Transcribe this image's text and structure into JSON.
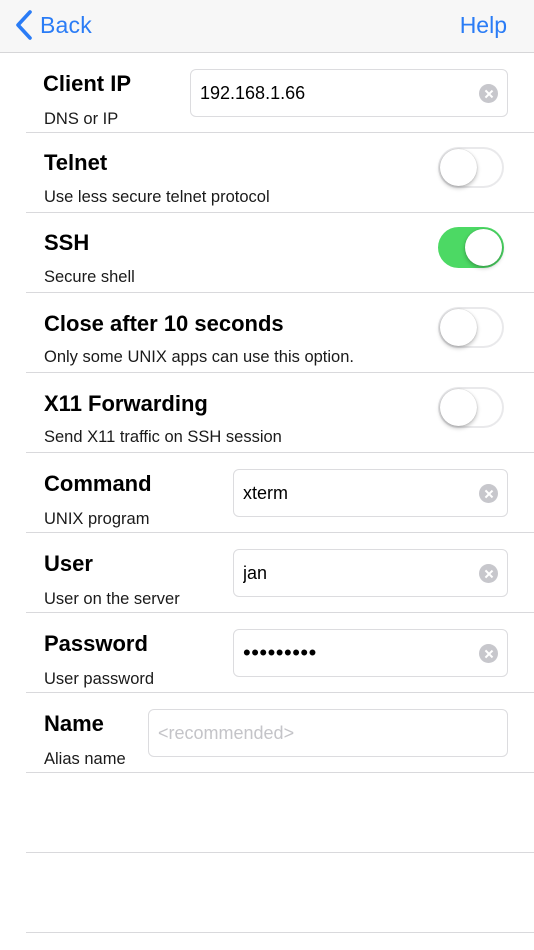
{
  "nav": {
    "back_label": "Back",
    "help_label": "Help",
    "accent": "#2a7cf6"
  },
  "rows": {
    "client_ip": {
      "title": "Client IP",
      "subtitle": "DNS or IP",
      "value": "192.168.1.66"
    },
    "telnet": {
      "title": "Telnet",
      "subtitle": "Use less secure telnet protocol",
      "enabled": false
    },
    "ssh": {
      "title": "SSH",
      "subtitle": "Secure shell",
      "enabled": true
    },
    "close_after": {
      "title": "Close after 10 seconds",
      "subtitle": "Only some UNIX apps can use this option.",
      "enabled": false
    },
    "x11": {
      "title": "X11 Forwarding",
      "subtitle": "Send X11 traffic on SSH session",
      "enabled": false
    },
    "command": {
      "title": "Command",
      "subtitle": "UNIX program",
      "value": "xterm"
    },
    "user": {
      "title": "User",
      "subtitle": "User on the server",
      "value": "jan"
    },
    "password": {
      "title": "Password",
      "subtitle": "User password",
      "value": "•••••••••"
    },
    "name": {
      "title": "Name",
      "subtitle": "Alias name",
      "value": "",
      "placeholder": "<recommended>"
    }
  },
  "icons": {
    "back": "chevron-left-icon",
    "clear": "clear-circle-icon"
  },
  "colors": {
    "toggle_on": "#4cd964",
    "toggle_off": "#e9e9eb"
  }
}
